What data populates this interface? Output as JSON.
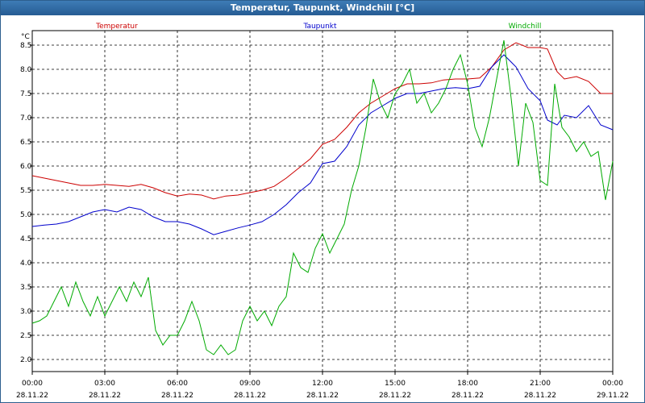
{
  "window": {
    "title": "Temperatur, Taupunkt, Windchill [°C]"
  },
  "chart_data": {
    "type": "line",
    "title": "Temperatur, Taupunkt, Windchill [°C]",
    "ylabel": "°C",
    "ylim": [
      1.75,
      8.8
    ],
    "xlim": [
      0,
      24
    ],
    "grid": true,
    "legend_position": "top",
    "y_ticks": [
      "2.0",
      "2.5",
      "3.0",
      "3.5",
      "4.0",
      "4.5",
      "5.0",
      "5.5",
      "6.0",
      "6.5",
      "7.0",
      "7.5",
      "8.0",
      "8.5"
    ],
    "x_ticks": [
      {
        "time": "00:00",
        "date": "28.11.22"
      },
      {
        "time": "03:00",
        "date": "28.11.22"
      },
      {
        "time": "06:00",
        "date": "28.11.22"
      },
      {
        "time": "09:00",
        "date": "28.11.22"
      },
      {
        "time": "12:00",
        "date": "28.11.22"
      },
      {
        "time": "15:00",
        "date": "28.11.22"
      },
      {
        "time": "18:00",
        "date": "28.11.22"
      },
      {
        "time": "21:00",
        "date": "28.11.22"
      },
      {
        "time": "00:00",
        "date": "29.11.22"
      }
    ],
    "series": [
      {
        "name": "Temperatur",
        "color": "#cc0000",
        "x": [
          0,
          0.5,
          1,
          1.5,
          2,
          2.5,
          3,
          3.5,
          4,
          4.5,
          5,
          5.5,
          6,
          6.5,
          7,
          7.5,
          8,
          8.5,
          9,
          9.5,
          10,
          10.5,
          11,
          11.5,
          12,
          12.5,
          13,
          13.5,
          14,
          14.5,
          15,
          15.5,
          16,
          16.5,
          17,
          17.5,
          18,
          18.5,
          19,
          19.5,
          20,
          20.5,
          21,
          21.3,
          21.7,
          22,
          22.5,
          23,
          23.5,
          24
        ],
        "y": [
          5.8,
          5.75,
          5.7,
          5.65,
          5.6,
          5.6,
          5.62,
          5.6,
          5.58,
          5.62,
          5.55,
          5.45,
          5.38,
          5.42,
          5.4,
          5.32,
          5.38,
          5.4,
          5.45,
          5.5,
          5.58,
          5.75,
          5.95,
          6.15,
          6.45,
          6.55,
          6.8,
          7.1,
          7.3,
          7.45,
          7.6,
          7.7,
          7.7,
          7.72,
          7.78,
          7.8,
          7.8,
          7.82,
          8.05,
          8.4,
          8.55,
          8.45,
          8.45,
          8.42,
          7.95,
          7.8,
          7.85,
          7.75,
          7.5,
          7.5
        ]
      },
      {
        "name": "Taupunkt",
        "color": "#0000cc",
        "x": [
          0,
          0.5,
          1,
          1.5,
          2,
          2.5,
          3,
          3.5,
          4,
          4.5,
          5,
          5.5,
          6,
          6.5,
          7,
          7.5,
          8,
          8.5,
          9,
          9.5,
          10,
          10.5,
          11,
          11.5,
          12,
          12.5,
          13,
          13.5,
          14,
          14.5,
          15,
          15.5,
          16,
          16.5,
          17,
          17.5,
          18,
          18.5,
          19,
          19.5,
          20,
          20.5,
          21,
          21.3,
          21.7,
          22,
          22.5,
          23,
          23.5,
          24
        ],
        "y": [
          4.75,
          4.78,
          4.8,
          4.85,
          4.95,
          5.05,
          5.1,
          5.05,
          5.15,
          5.1,
          4.95,
          4.85,
          4.85,
          4.8,
          4.7,
          4.58,
          4.65,
          4.72,
          4.78,
          4.85,
          5.0,
          5.2,
          5.45,
          5.65,
          6.05,
          6.1,
          6.4,
          6.85,
          7.1,
          7.25,
          7.4,
          7.5,
          7.5,
          7.55,
          7.6,
          7.62,
          7.6,
          7.65,
          8.05,
          8.3,
          8.05,
          7.6,
          7.35,
          6.95,
          6.85,
          7.05,
          7.0,
          7.25,
          6.85,
          6.75
        ]
      },
      {
        "name": "Windchill",
        "color": "#00aa00",
        "x": [
          0,
          0.3,
          0.6,
          0.9,
          1.2,
          1.5,
          1.8,
          2.1,
          2.4,
          2.7,
          3.0,
          3.3,
          3.6,
          3.9,
          4.2,
          4.5,
          4.8,
          5.1,
          5.4,
          5.7,
          6.0,
          6.3,
          6.6,
          6.9,
          7.2,
          7.5,
          7.8,
          8.1,
          8.4,
          8.7,
          9.0,
          9.3,
          9.6,
          9.9,
          10.2,
          10.5,
          10.8,
          11.1,
          11.4,
          11.7,
          12.0,
          12.3,
          12.6,
          12.9,
          13.2,
          13.5,
          13.8,
          14.1,
          14.4,
          14.7,
          15.0,
          15.3,
          15.6,
          15.9,
          16.2,
          16.5,
          16.8,
          17.1,
          17.4,
          17.7,
          18.0,
          18.3,
          18.6,
          18.9,
          19.2,
          19.5,
          19.8,
          20.1,
          20.4,
          20.7,
          21.0,
          21.3,
          21.6,
          21.9,
          22.2,
          22.5,
          22.8,
          23.1,
          23.4,
          23.7,
          24.0
        ],
        "y": [
          2.75,
          2.8,
          2.9,
          3.2,
          3.5,
          3.1,
          3.6,
          3.2,
          2.9,
          3.3,
          2.9,
          3.2,
          3.5,
          3.2,
          3.6,
          3.3,
          3.7,
          2.6,
          2.3,
          2.5,
          2.5,
          2.8,
          3.2,
          2.8,
          2.2,
          2.1,
          2.3,
          2.1,
          2.2,
          2.8,
          3.1,
          2.8,
          3.0,
          2.7,
          3.1,
          3.3,
          4.2,
          3.9,
          3.8,
          4.3,
          4.6,
          4.2,
          4.5,
          4.8,
          5.5,
          6.0,
          6.8,
          7.8,
          7.3,
          7.0,
          7.5,
          7.7,
          8.0,
          7.3,
          7.5,
          7.1,
          7.3,
          7.6,
          8.0,
          8.3,
          7.7,
          6.8,
          6.4,
          7.0,
          7.8,
          8.6,
          7.4,
          6.0,
          7.3,
          6.9,
          5.7,
          5.6,
          7.7,
          6.8,
          6.6,
          6.3,
          6.5,
          6.2,
          6.3,
          5.3,
          6.1
        ]
      }
    ]
  }
}
